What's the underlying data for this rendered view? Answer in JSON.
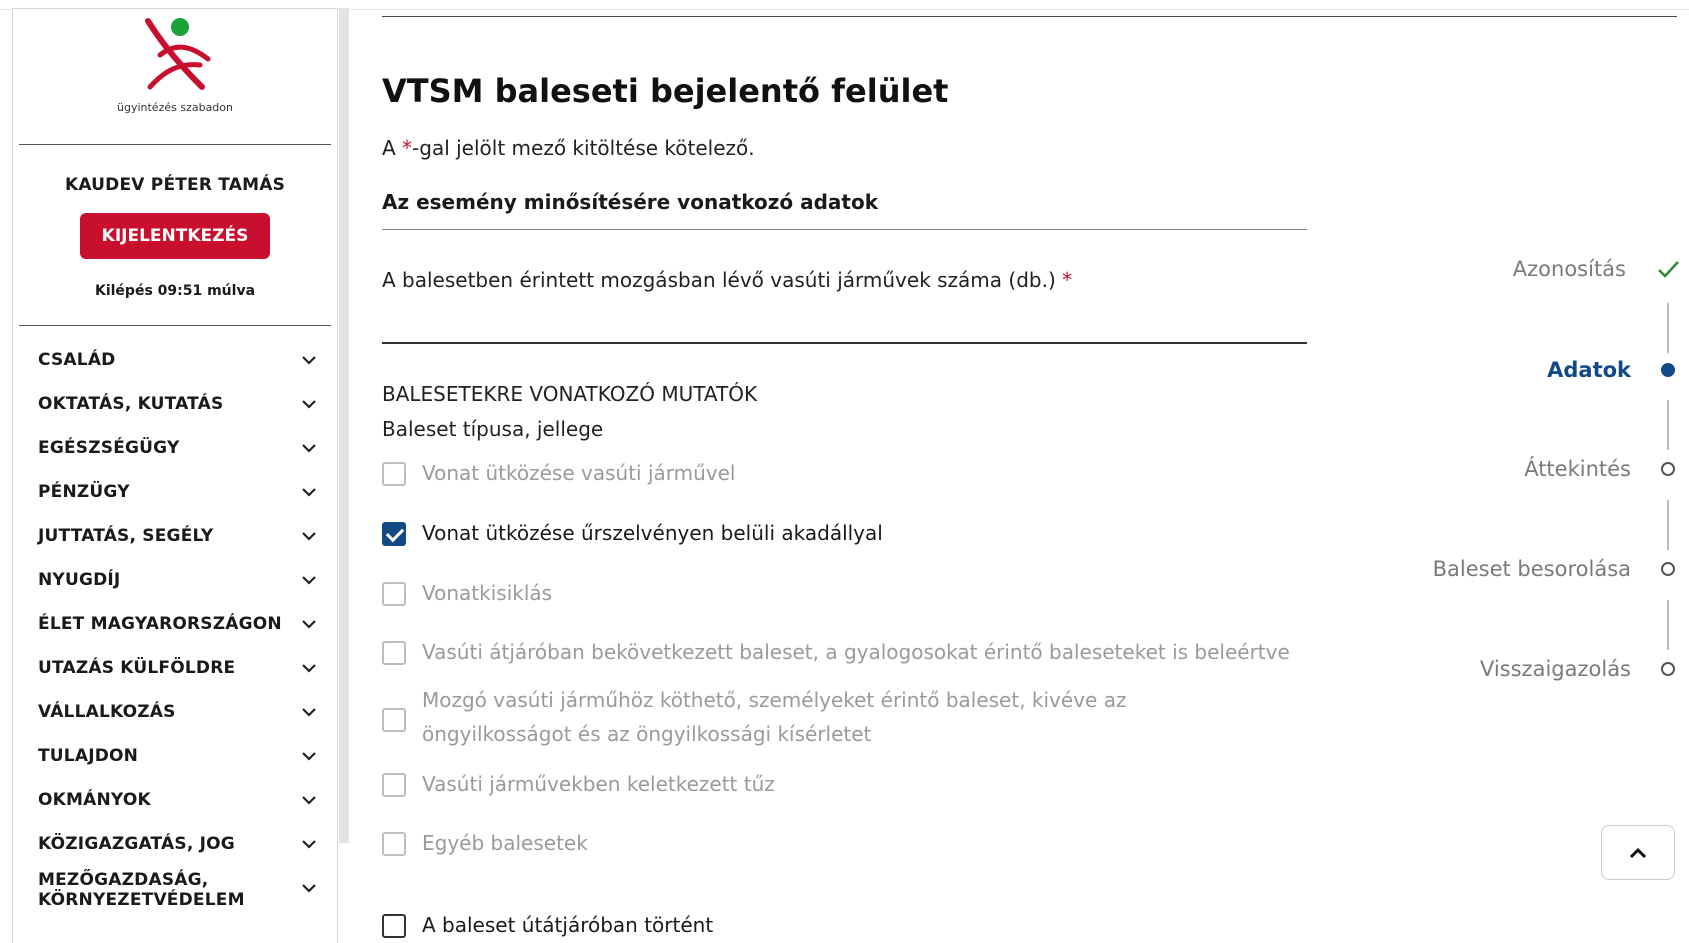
{
  "sidebar": {
    "logo_text": "ügyintézés szabadon",
    "user_name": "KAUDEV PÉTER TAMÁS",
    "logout_label": "KIJELENTKEZÉS",
    "timer": "Kilépés 09:51 múlva",
    "nav": [
      "CSALÁD",
      "OKTATÁS, KUTATÁS",
      "EGÉSZSÉGÜGY",
      "PÉNZÜGY",
      "JUTTATÁS, SEGÉLY",
      "NYUGDÍJ",
      "ÉLET MAGYARORSZÁGON",
      "UTAZÁS KÜLFÖLDRE",
      "VÁLLALKOZÁS",
      "TULAJDON",
      "OKMÁNYOK",
      "KÖZIGAZGATÁS, JOG",
      "MEZŐGAZDASÁG, KÖRNYEZETVÉDELEM"
    ]
  },
  "main": {
    "title": "VTSM baleseti bejelentő felület",
    "required_note_prefix": "A ",
    "required_star": "*",
    "required_note_suffix": "-gal jelölt mező kitöltése kötelező.",
    "section_title": "Az esemény minősítésére vonatkozó adatok",
    "vehicles_label": "A balesetben érintett mozgásban lévő vasúti járművek száma (db.)",
    "vehicles_star": "*",
    "vehicles_value": "",
    "indicators_title": "BALESETEKRE VONATKOZÓ MUTATÓK",
    "type_label": "Baleset típusa, jellege",
    "options": [
      {
        "label": "Vonat ütközése vasúti járművel",
        "checked": false
      },
      {
        "label": "Vonat ütközése űrszelvényen belüli akadállyal",
        "checked": true
      },
      {
        "label": "Vonatkisiklás",
        "checked": false
      },
      {
        "label": "Vasúti átjáróban bekövetkezett baleset, a gyalogosokat érintő baleseteket is beleértve",
        "checked": false
      },
      {
        "label": "Mozgó vasúti járműhöz köthető, személyeket érintő baleset, kivéve az öngyilkosságot és az öngyilkossági kísérletet",
        "checked": false
      },
      {
        "label": "Vasúti járművekben keletkezett tűz",
        "checked": false
      },
      {
        "label": "Egyéb balesetek",
        "checked": false
      }
    ],
    "crossing_label": "A baleset útátjáróban történt",
    "crossing_checked": false
  },
  "stepper": {
    "steps": [
      {
        "label": "Azonosítás",
        "state": "done"
      },
      {
        "label": "Adatok",
        "state": "active"
      },
      {
        "label": "Áttekintés",
        "state": "pending"
      },
      {
        "label": "Baleset besorolása",
        "state": "pending"
      },
      {
        "label": "Visszaigazolás",
        "state": "pending"
      }
    ]
  },
  "colors": {
    "brand_red": "#c8102e",
    "brand_blue": "#134a86",
    "check_green": "#2e8b3a",
    "logo_green": "#1aa33a"
  },
  "icons": {
    "scroll_top": "chevron-up-icon",
    "nav_chevron": "chevron-down-icon",
    "step_done": "check-icon"
  }
}
